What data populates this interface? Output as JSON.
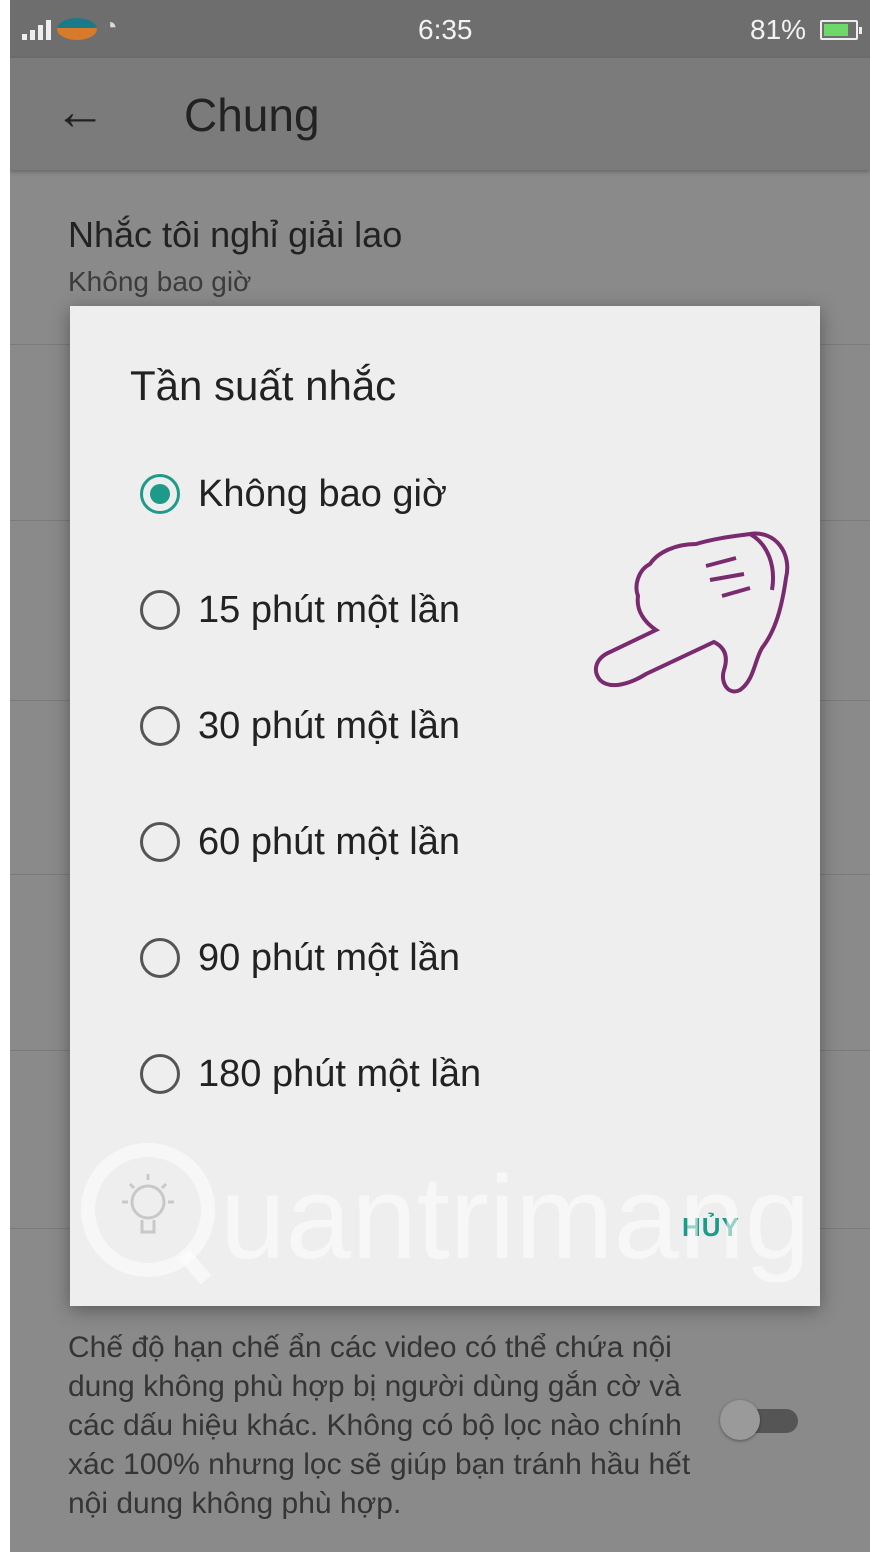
{
  "status_bar": {
    "time": "6:35",
    "battery": "81%"
  },
  "app_bar": {
    "title": "Chung"
  },
  "settings": [
    {
      "title": "Nhắc tôi nghỉ giải lao",
      "subtitle": "Không bao giờ"
    }
  ],
  "restricted_mode": {
    "description": "Chế độ hạn chế ẩn các video có thể chứa nội dung không phù hợp bị người dùng gắn cờ và các dấu hiệu khác. Không có bộ lọc nào chính xác 100% nhưng lọc sẽ giúp bạn tránh hầu hết nội dung không phù hợp."
  },
  "dialog": {
    "title": "Tần suất nhắc",
    "options": [
      {
        "label": "Không bao giờ",
        "selected": true
      },
      {
        "label": "15 phút một lần",
        "selected": false
      },
      {
        "label": "30 phút một lần",
        "selected": false
      },
      {
        "label": "60 phút một lần",
        "selected": false
      },
      {
        "label": "90 phút một lần",
        "selected": false
      },
      {
        "label": "180 phút một lần",
        "selected": false
      }
    ],
    "cancel_label": "HỦY"
  },
  "watermark": {
    "text": "uantrimang"
  },
  "colors": {
    "accent": "#1e9a8a",
    "hand_outline": "#7a2a6e"
  }
}
